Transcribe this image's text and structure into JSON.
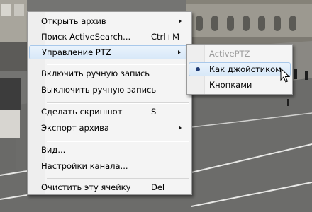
{
  "menu": {
    "items": [
      {
        "label": "Открыть архив",
        "shortcut": "",
        "submenu": true
      },
      {
        "label": "Поиск ActiveSearch...",
        "shortcut": "Ctrl+M",
        "submenu": false
      },
      {
        "label": "Управление PTZ",
        "shortcut": "",
        "submenu": true,
        "highlighted": true
      },
      {
        "label": "Включить ручную запись",
        "shortcut": "",
        "submenu": false
      },
      {
        "label": "Выключить ручную запись",
        "shortcut": "",
        "submenu": false
      },
      {
        "label": "Сделать скриншот",
        "shortcut": "S",
        "submenu": false
      },
      {
        "label": "Экспорт архива",
        "shortcut": "",
        "submenu": true
      },
      {
        "label": "Вид...",
        "shortcut": "",
        "submenu": false
      },
      {
        "label": "Настройки канала...",
        "shortcut": "",
        "submenu": false
      },
      {
        "label": "Очистить эту ячейку",
        "shortcut": "Del",
        "submenu": false
      }
    ]
  },
  "submenu": {
    "items": [
      {
        "label": "ActivePTZ",
        "disabled": true
      },
      {
        "label": "Как джойстиком",
        "selected": true,
        "highlighted": true
      },
      {
        "label": "Кнопками"
      }
    ]
  },
  "colors": {
    "highlight_fill": "#dce9f7",
    "highlight_border": "#a8c8ea",
    "menu_bg": "#f4f4f4",
    "disabled_text": "#9b9b9b"
  },
  "icons": {
    "submenu_arrow": "chevron-right-icon",
    "radio": "radio-dot-icon",
    "cursor": "mouse-pointer-icon"
  }
}
